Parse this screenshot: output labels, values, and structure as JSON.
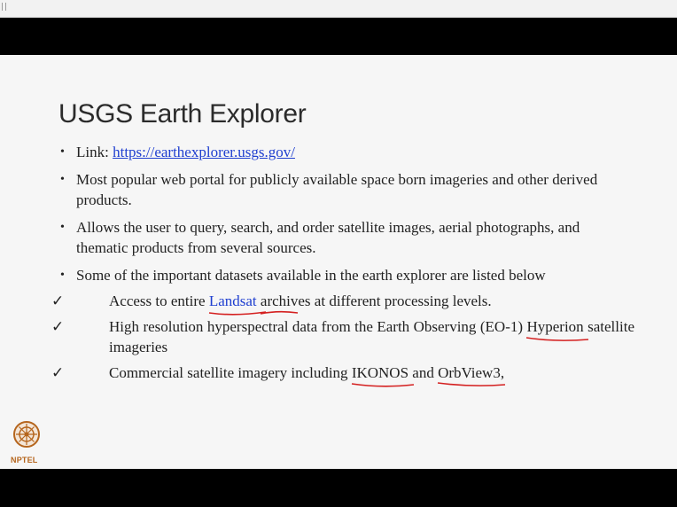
{
  "slide": {
    "title": "USGS Earth Explorer",
    "bullets": [
      {
        "prefix": "Link: ",
        "link": "https://earthexplorer.usgs.gov/"
      },
      {
        "text": "Most popular web portal for publicly available space born imageries and other derived products."
      },
      {
        "text": "Allows the user to query, search, and order satellite images, aerial photographs, and thematic products from several sources."
      },
      {
        "text": "Some of the important datasets available in the earth explorer are listed below"
      }
    ],
    "checks": [
      {
        "pre": "Access to entire ",
        "highlight": "Landsat",
        "mid": " ",
        "u2": "archi",
        "post": "ves at different processing levels."
      },
      {
        "pre": "High resolution hyperspectral data from the Earth Observing (EO-1) ",
        "u1": "Hyperion",
        "post": "  satellite imageries"
      },
      {
        "pre": "Commercial satellite imagery including ",
        "u1": "IKONOS",
        "mid": " and ",
        "u2": "OrbView3",
        "post": ","
      }
    ],
    "check_symbol": "✓",
    "bullet_symbol": "•"
  },
  "logo": {
    "label": "NPTEL"
  },
  "colors": {
    "link": "#1f3fd0",
    "underline": "#d42020",
    "bars": "#000000"
  }
}
